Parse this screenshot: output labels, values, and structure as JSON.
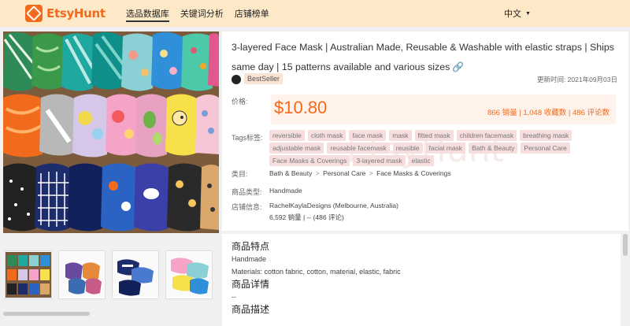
{
  "brand": {
    "name": "EtsyHunt",
    "accent": "#f26a1b"
  },
  "nav": [
    {
      "label": "选品数据库",
      "active": true
    },
    {
      "label": "关键词分析",
      "active": false
    },
    {
      "label": "店铺榜单",
      "active": false
    }
  ],
  "language": {
    "label": "中文"
  },
  "product": {
    "title": "3-layered Face Mask | Australian Made, Reusable & Washable with elastic straps | Ships same day | 15 patterns available and various sizes",
    "badge": "BestSeller",
    "updated": "更新时间: 2021年09月03日",
    "price_label": "价格:",
    "price": "$10.80",
    "stats": "866 销量 | 1,048 收藏数 | 486 评论数",
    "tags_label": "Tags标签:",
    "tags": [
      "reversible",
      "cloth mask",
      "face mask",
      "mask",
      "fitted mask",
      "children facemask",
      "breathing mask",
      "adjustable mask",
      "reusable facemask",
      "reusible",
      "facial mask",
      "Bath & Beauty",
      "Personal Care",
      "Face Masks & Coverings",
      "3-layered mask",
      "elastic"
    ],
    "watermark": "EtsyHunt",
    "category_label": "类目:",
    "category": [
      "Bath & Beauty",
      "Personal Care",
      "Face Masks & Coverings"
    ],
    "type_label": "商品类型:",
    "type": "Handmade",
    "shop_label": "店铺信息:",
    "shop_name": "RachelKaylaDesigns (Melbourne, Australia)",
    "shop_stats": "6,592 销量 | -- (486 评论)"
  },
  "description": {
    "features_heading": "商品特点",
    "features_type": "Handmade",
    "materials": "Materials: cotton fabric, cotton, material, elastic, fabric",
    "details_heading": "商品详情",
    "details_value": "--",
    "desc_heading": "商品描述"
  },
  "icons": {
    "link": "link-icon",
    "badge": "bestseller-icon",
    "caret": "chevron-down-icon"
  }
}
